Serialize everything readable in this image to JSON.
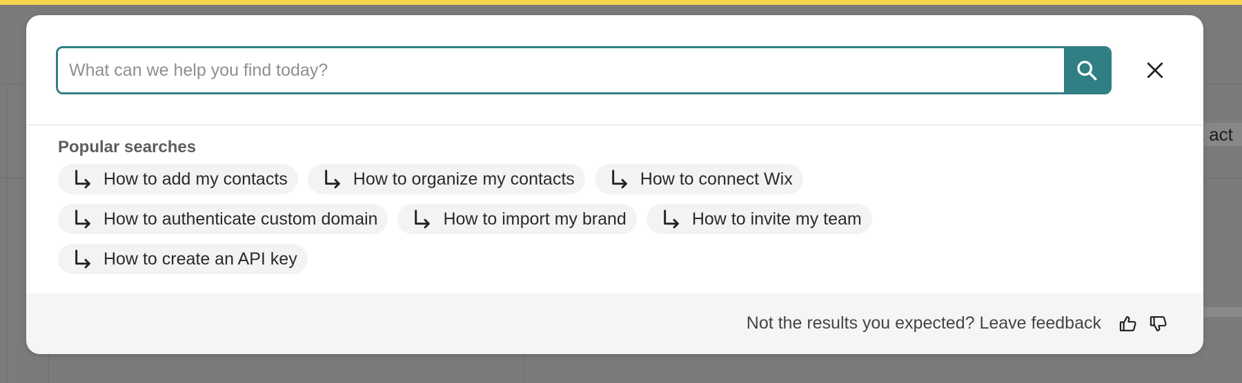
{
  "search": {
    "placeholder": "What can we help you find today?",
    "value": ""
  },
  "popular": {
    "title": "Popular searches",
    "items": [
      "How to add my contacts",
      "How to organize my contacts",
      "How to connect Wix",
      "How to authenticate custom domain",
      "How to import my brand",
      "How to invite my team",
      "How to create an API key"
    ]
  },
  "footer": {
    "feedback_text": "Not the results you expected? Leave feedback"
  },
  "background": {
    "snippet": "k act"
  },
  "colors": {
    "accent": "#2f7f85",
    "top_bar": "#f7d64c",
    "overlay": "#7b7b7b"
  },
  "icons": {
    "search": "search-icon",
    "close": "close-icon",
    "chip": "arrow-turn-down-right-icon",
    "thumbs_up": "thumbs-up-icon",
    "thumbs_down": "thumbs-down-icon"
  }
}
